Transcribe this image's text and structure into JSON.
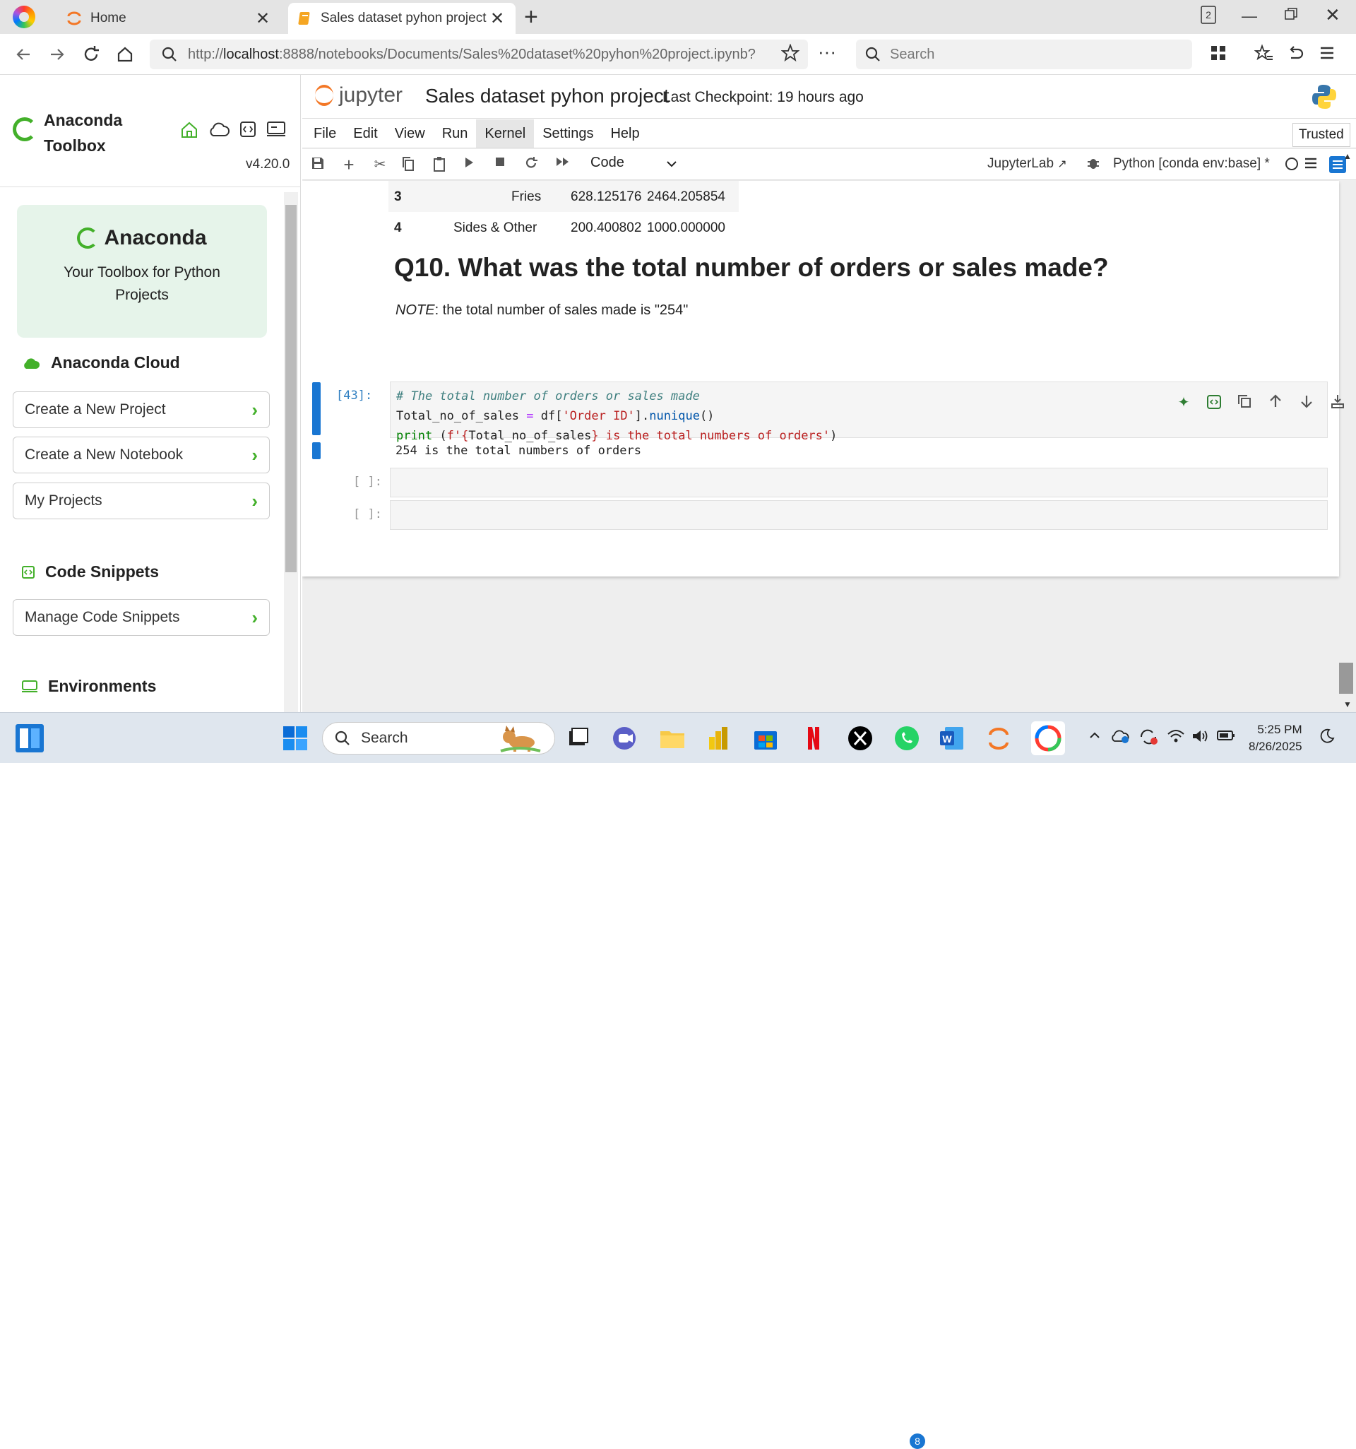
{
  "browser": {
    "tabs": [
      {
        "title": "Home",
        "active": false
      },
      {
        "title": "Sales dataset pyhon project",
        "active": true
      }
    ],
    "tab_count_badge": "2",
    "url_prefix": "http://",
    "url_host": "localhost",
    "url_rest": ":8888/notebooks/Documents/Sales%20dataset%20pyhon%20project.ipynb?",
    "search_placeholder": "Search"
  },
  "toolbox": {
    "title_line1": "Anaconda",
    "title_line2": "Toolbox",
    "version": "v4.20.0",
    "hero_brand": "Anaconda",
    "hero_subtitle": "Your Toolbox for Python Projects",
    "cloud_heading": "Anaconda Cloud",
    "buttons": [
      {
        "label": "Create a New Project"
      },
      {
        "label": "Create a New Notebook"
      },
      {
        "label": "My Projects"
      }
    ],
    "snippets_heading": "Code Snippets",
    "snippets_button": "Manage Code Snippets",
    "env_heading": "Environments"
  },
  "jupyter": {
    "brand": "jupyter",
    "notebook_name": "Sales dataset pyhon project",
    "checkpoint": "Last Checkpoint: 19 hours ago",
    "menu": [
      "File",
      "Edit",
      "View",
      "Run",
      "Kernel",
      "Settings",
      "Help"
    ],
    "trusted": "Trusted",
    "cell_type": "Code",
    "jupyterlab_link": "JupyterLab",
    "kernel": "Python [conda env:base] *"
  },
  "notebook": {
    "dataframe_rows": [
      {
        "index": "3",
        "category": "Fries",
        "col1": "628.125176",
        "col2": "2464.205854"
      },
      {
        "index": "4",
        "category": "Sides & Other",
        "col1": "200.400802",
        "col2": "1000.000000"
      }
    ],
    "heading": "Q10. What was the total number of orders or sales made?",
    "note_label": "NOTE",
    "note_text": ": the total number of sales made is \"254\"",
    "cell_prompt": "[43]:",
    "code": {
      "comment": "# The total number of orders or sales made",
      "line2_a": "Total_no_of_sales ",
      "line2_eq": "=",
      "line2_b": " df[",
      "line2_str": "'Order ID'",
      "line2_c": "].",
      "line2_fn": "nunique",
      "line2_d": "()",
      "line3_kw": "print",
      "line3_a": " (",
      "line3_str1": "f'{",
      "line3_b": "Total_no_of_sales",
      "line3_str2": "} is the total numbers of orders'",
      "line3_c": ")"
    },
    "output": "254 is the total numbers of orders",
    "empty_prompt": "[ ]:"
  },
  "taskbar": {
    "search_placeholder": "Search",
    "whatsapp_badge": "8",
    "time": "5:25 PM",
    "date": "8/26/2025"
  },
  "colors": {
    "anaconda_green": "#43b02a",
    "jupyter_orange": "#f37726",
    "active_cell": "#1976d2"
  }
}
